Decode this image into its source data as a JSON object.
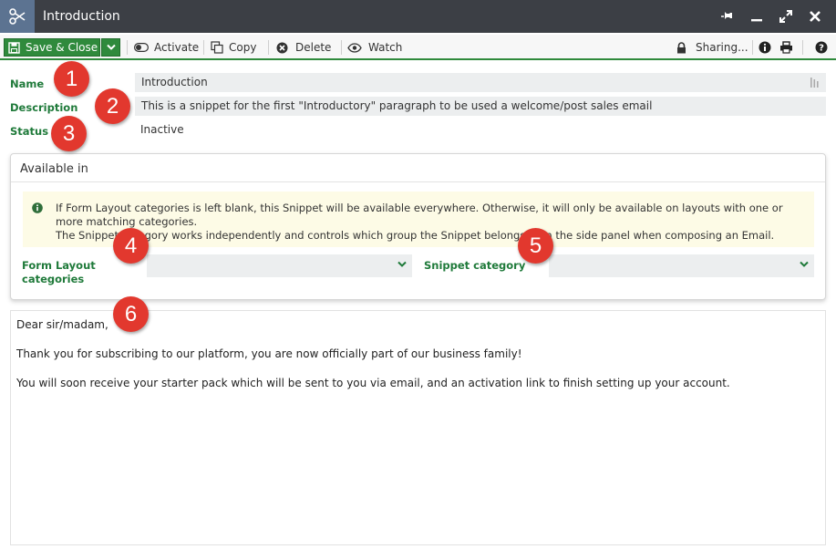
{
  "window": {
    "title": "Introduction",
    "app_icon": "scissors-icon"
  },
  "toolbar": {
    "save_close": "Save & Close",
    "activate": "Activate",
    "copy": "Copy",
    "delete": "Delete",
    "watch": "Watch",
    "sharing": "Sharing..."
  },
  "fields": {
    "name_label": "Name",
    "name_value": "Introduction",
    "description_label": "Description",
    "description_value": "This is a snippet for the first \"Introductory\" paragraph to be used a welcome/post sales email",
    "status_label": "Status",
    "status_value": "Inactive"
  },
  "available_in": {
    "title": "Available in",
    "notice_line1": "If Form Layout categories is left blank, this Snippet will be available everywhere. Otherwise, it will only be available on layouts with one or more matching categories.",
    "notice_line2": "The Snippet category works independently and controls which group the Snippet belongs to in the side panel when composing an Email.",
    "form_layout_label": "Form Layout categories",
    "form_layout_value": "",
    "snippet_category_label": "Snippet category",
    "snippet_category_value": ""
  },
  "editor": {
    "lines": [
      "Dear sir/madam,",
      "Thank you for subscribing to our platform, you are now officially part of our business family!",
      "You will soon receive your starter pack which will be sent to you via email, and an activation link to finish setting up your account."
    ]
  },
  "markers": [
    "1",
    "2",
    "3",
    "4",
    "5",
    "6"
  ],
  "colors": {
    "accent_green": "#2f8a3c",
    "label_green": "#1f7a3a",
    "titlebar": "#3c3f45",
    "marker_red": "#e2382e",
    "notice_bg": "#fdfbe6"
  }
}
